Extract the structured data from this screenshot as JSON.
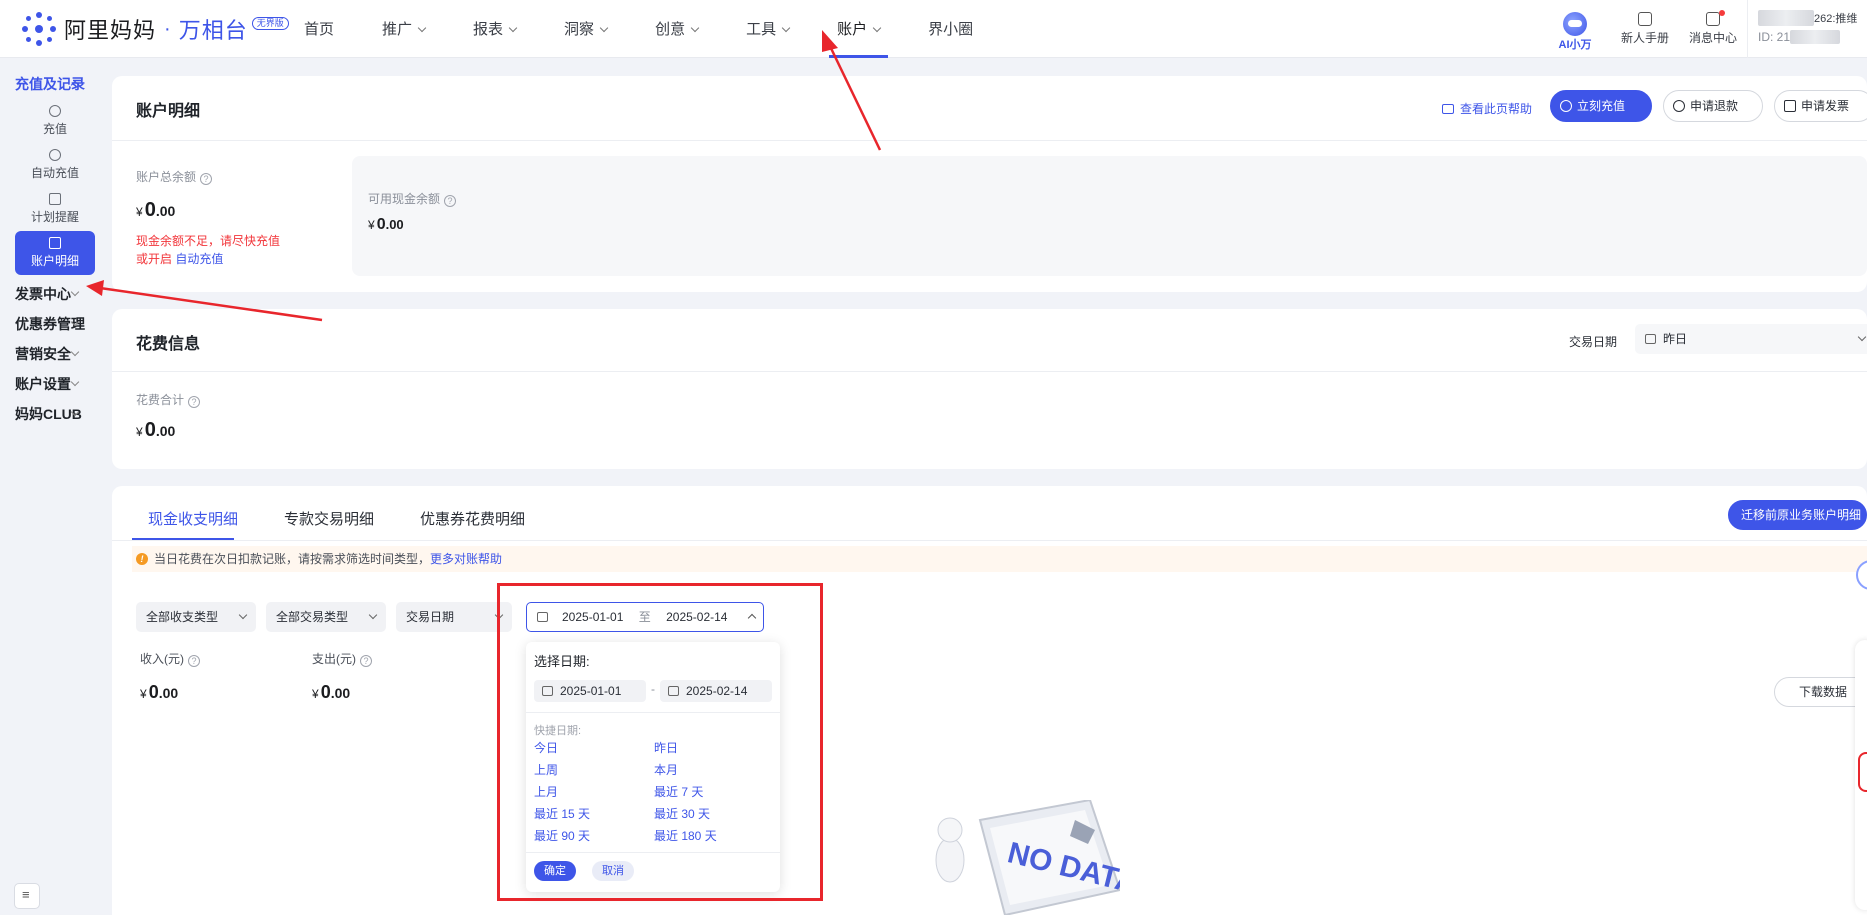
{
  "brand": {
    "name": "阿里妈妈",
    "dot": "·",
    "product": "万相台",
    "badge": "无界版"
  },
  "nav": [
    {
      "label": "首页",
      "has_menu": false,
      "active": false
    },
    {
      "label": "推广",
      "has_menu": true,
      "active": false
    },
    {
      "label": "报表",
      "has_menu": true,
      "active": false
    },
    {
      "label": "洞察",
      "has_menu": true,
      "active": false
    },
    {
      "label": "创意",
      "has_menu": true,
      "active": false
    },
    {
      "label": "工具",
      "has_menu": true,
      "active": false
    },
    {
      "label": "账户",
      "has_menu": true,
      "active": true
    },
    {
      "label": "界小圈",
      "has_menu": false,
      "active": false
    }
  ],
  "topright": {
    "ai_label": "AI小万",
    "guide_label": "新人手册",
    "message_label": "消息中心",
    "user_name_suffix": "262:推维",
    "user_id_label": "ID: 21"
  },
  "sidebar": {
    "group_recharge": "充值及记录",
    "items": [
      {
        "label": "充值",
        "icon": "recharge-icon",
        "active": false
      },
      {
        "label": "自动充值",
        "icon": "auto-recharge-icon",
        "active": false
      },
      {
        "label": "计划提醒",
        "icon": "plan-reminder-icon",
        "active": false
      },
      {
        "label": "账户明细",
        "icon": "account-detail-icon",
        "active": true
      }
    ],
    "groups": [
      "发票中心",
      "优惠券管理",
      "营销安全",
      "账户设置",
      "妈妈CLUB"
    ]
  },
  "account": {
    "title": "账户明细",
    "help_link": "查看此页帮助",
    "btn_recharge": "立刻充值",
    "btn_refund": "申请退款",
    "btn_invoice": "申请发票",
    "total_label": "账户总余额",
    "total_value": {
      "currency": "¥",
      "int": "0",
      "dec": ".00"
    },
    "warning_line1": "现金余额不足，请尽快充值",
    "warning_line2_prefix": "或开启",
    "warning_link": "自动充值",
    "cash_label": "可用现金余额",
    "cash_value": {
      "currency": "¥",
      "int": "0",
      "dec": ".00"
    }
  },
  "spend": {
    "title": "花费信息",
    "date_label": "交易日期",
    "date_value": "昨日",
    "sum_label": "花费合计",
    "sum_value": {
      "currency": "¥",
      "int": "0",
      "dec": ".00"
    }
  },
  "details": {
    "tabs": [
      "现金收支明细",
      "专款交易明细",
      "优惠券花费明细"
    ],
    "migrate_btn": "迁移前原业务账户明细",
    "notice_text": "当日花费在次日扣款记账，请按需求筛选时间类型，",
    "notice_link": "更多对账帮助",
    "filter_type": "全部收支类型",
    "filter_trade": "全部交易类型",
    "filter_date_type": "交易日期",
    "range_start": "2025-01-01",
    "range_sep": "至",
    "range_end": "2025-02-14",
    "income_label": "收入(元)",
    "income_value": {
      "currency": "¥",
      "int": "0",
      "dec": ".00"
    },
    "expense_label": "支出(元)",
    "expense_value": {
      "currency": "¥",
      "int": "0",
      "dec": ".00"
    },
    "download_btn": "下载数据"
  },
  "datepicker": {
    "title": "选择日期:",
    "start": "2025-01-01",
    "dash": "-",
    "end": "2025-02-14",
    "quick_label": "快捷日期:",
    "quick": [
      "今日",
      "昨日",
      "上周",
      "本月",
      "上月",
      "最近 7 天",
      "最近 15 天",
      "最近 30 天",
      "最近 90 天",
      "最近 180 天"
    ],
    "ok": "确定",
    "cancel": "取消"
  },
  "nodata_text": "NO DATA",
  "colors": {
    "primary": "#3e55e8",
    "warning_text": "#f2353a",
    "annotation_red": "#e8262c",
    "notice_bg": "#fff7ef"
  }
}
